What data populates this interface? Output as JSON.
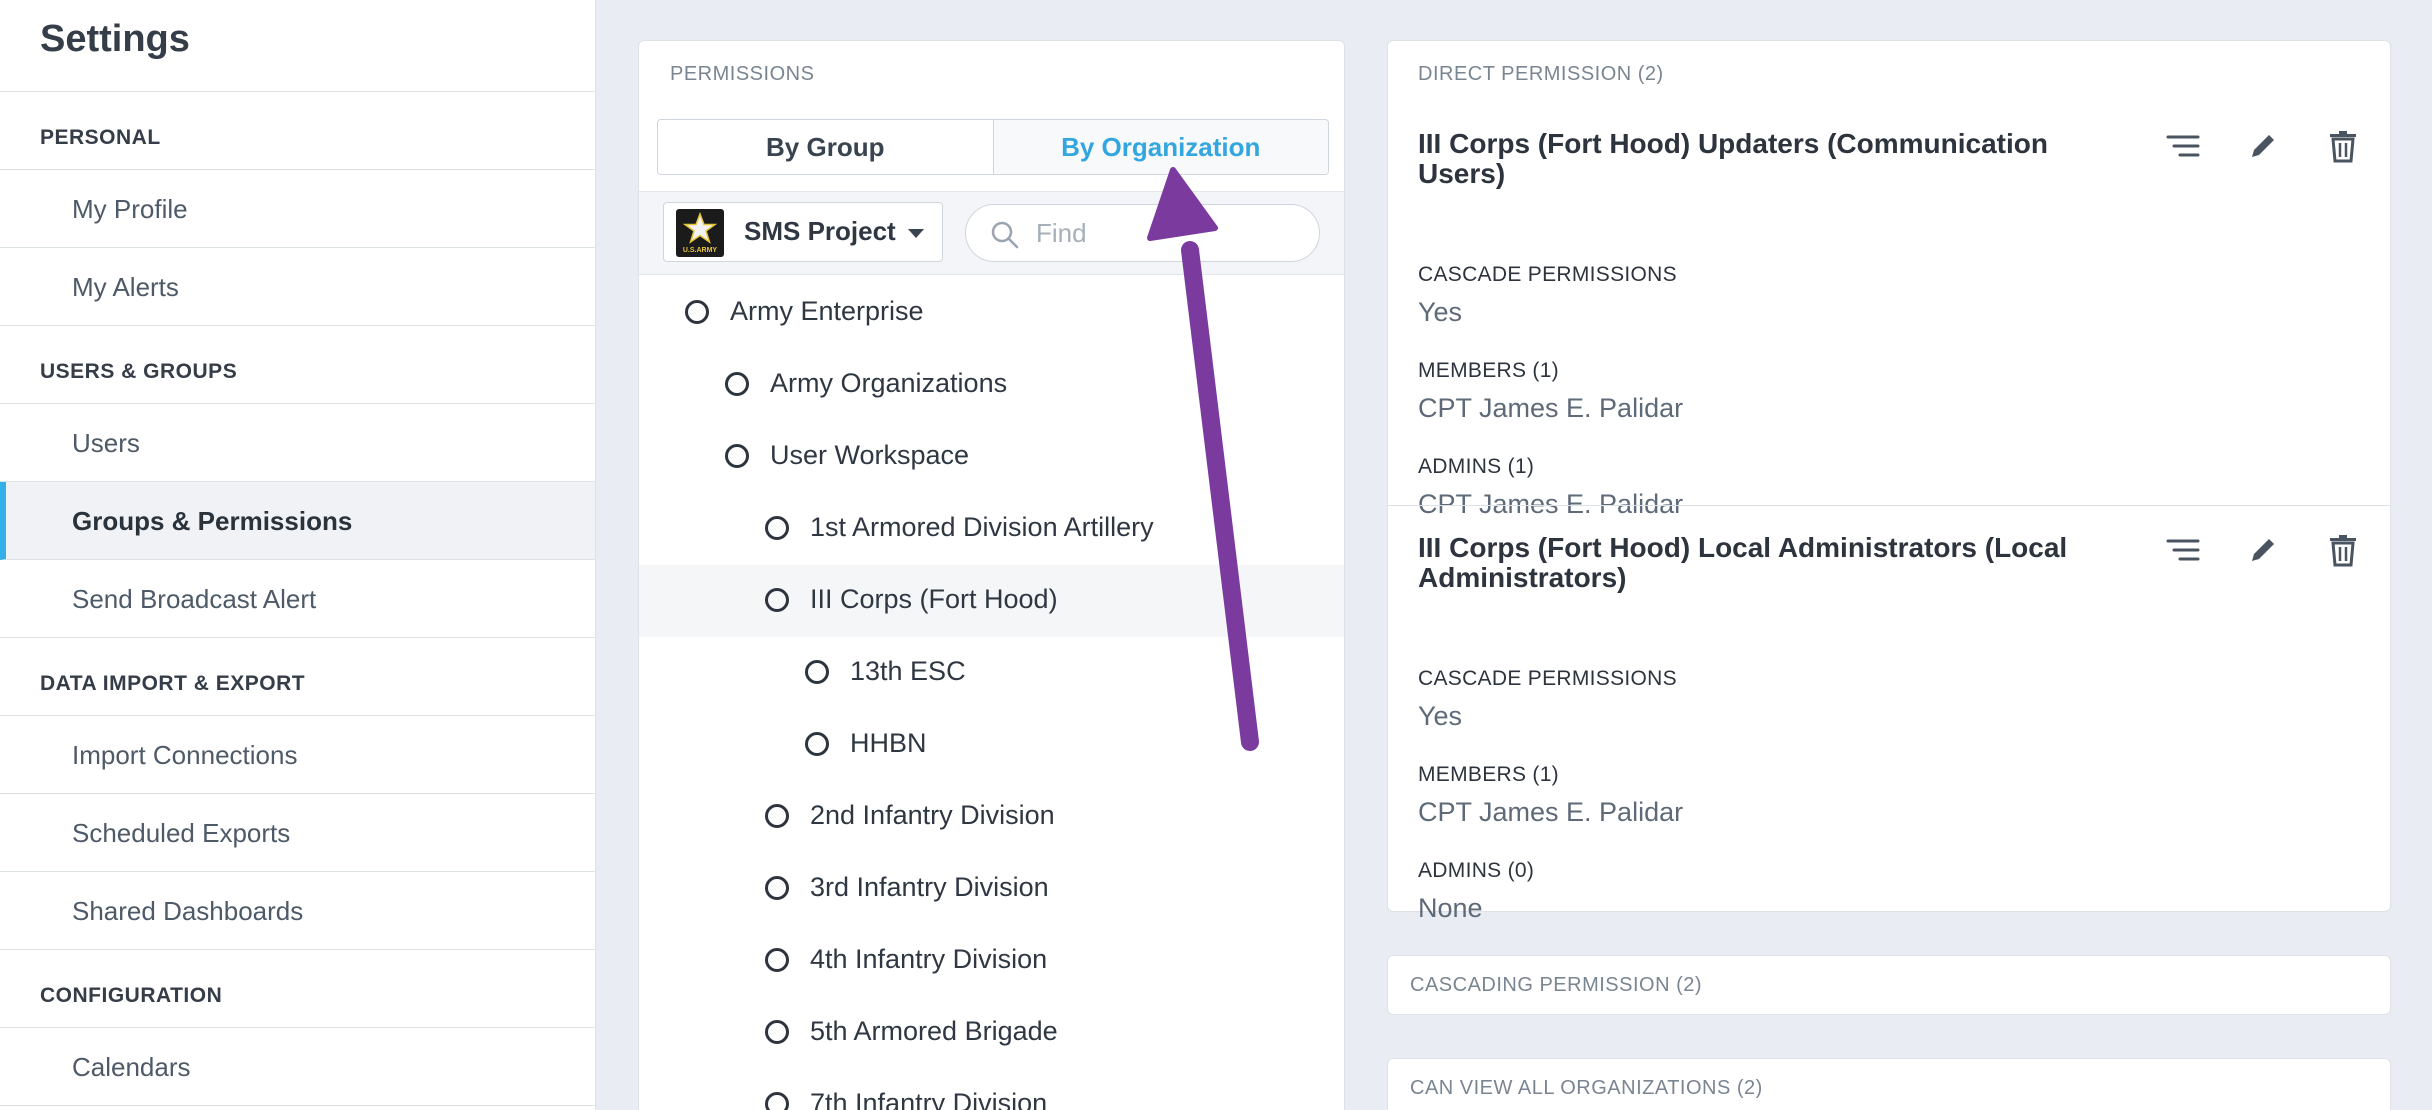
{
  "sidebar": {
    "title": "Settings",
    "sections": [
      {
        "heading": "PERSONAL",
        "items": [
          "My Profile",
          "My Alerts"
        ]
      },
      {
        "heading": "USERS & GROUPS",
        "items": [
          "Users",
          "Groups & Permissions",
          "Send Broadcast Alert"
        ]
      },
      {
        "heading": "DATA IMPORT & EXPORT",
        "items": [
          "Import Connections",
          "Scheduled Exports",
          "Shared Dashboards"
        ]
      },
      {
        "heading": "CONFIGURATION",
        "items": [
          "Calendars"
        ]
      }
    ],
    "active_item": "Groups & Permissions"
  },
  "permissions": {
    "label": "PERMISSIONS",
    "tabs": [
      "By Group",
      "By Organization"
    ],
    "active_tab": "By Organization",
    "project": "SMS Project",
    "logo_text": "U.S.ARMY",
    "search_placeholder": "Find",
    "tree": [
      "Army Enterprise",
      "Army Organizations",
      "User Workspace",
      "1st Armored Division Artillery",
      "III Corps (Fort Hood)",
      "13th ESC",
      "HHBN",
      "2nd Infantry Division",
      "3rd Infantry Division",
      "4th Infantry Division",
      "5th Armored Brigade",
      "7th Infantry Division"
    ],
    "selected": "III Corps (Fort Hood)"
  },
  "direct": {
    "heading": "DIRECT PERMISSION (2)",
    "items": [
      {
        "title": "III Corps (Fort Hood) Updaters (Communication Users)",
        "cascade_label": "CASCADE PERMISSIONS",
        "cascade_value": "Yes",
        "members_label": "MEMBERS (1)",
        "members_value": "CPT James E. Palidar",
        "admins_label": "ADMINS (1)",
        "admins_value": "CPT James E. Palidar"
      },
      {
        "title": "III Corps (Fort Hood) Local Administrators (Local Administrators)",
        "cascade_label": "CASCADE PERMISSIONS",
        "cascade_value": "Yes",
        "members_label": "MEMBERS (1)",
        "members_value": "CPT James E. Palidar",
        "admins_label": "ADMINS (0)",
        "admins_value": "None"
      }
    ]
  },
  "cascading_heading": "CASCADING PERMISSION (2)",
  "view_all_heading": "CAN VIEW ALL ORGANIZATIONS (2)",
  "colors": {
    "accent": "#33a6e0",
    "annotation_arrow": "#7b3a9e",
    "background": "#e9edf3"
  }
}
